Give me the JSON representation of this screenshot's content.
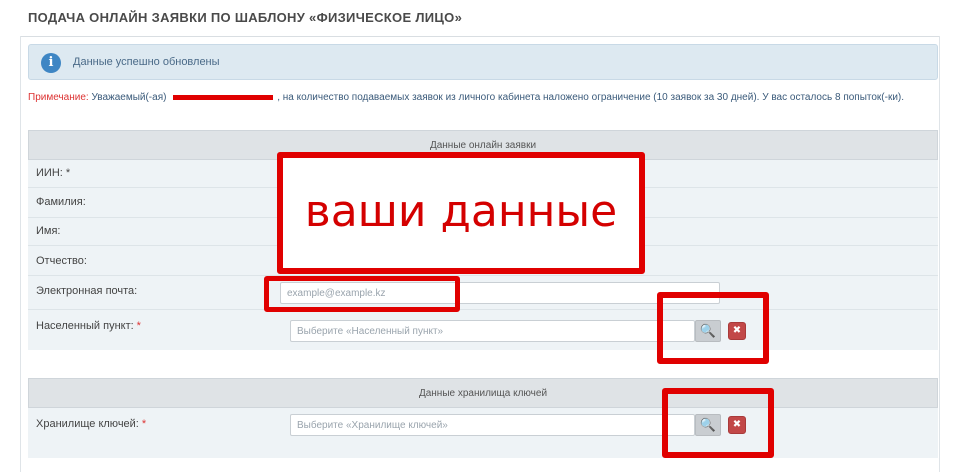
{
  "page": {
    "title": "ПОДАЧА ОНЛАЙН ЗАЯВКИ ПО ШАБЛОНУ «ФИЗИЧЕСКОЕ ЛИЦО»"
  },
  "info": {
    "icon": "info-icon",
    "text": "Данные успешно обновлены"
  },
  "warning": {
    "label": "Примечание:",
    "before": "Уважаемый(-ая)",
    "after": ", на количество подаваемых заявок из личного кабинета наложено ограничение (10 заявок за 30 дней). У вас осталось 8 попыток(-ки)."
  },
  "section1": {
    "title": "Данные онлайн заявки",
    "fields": {
      "iin": "ИИН: *",
      "lastname": "Фамилия:",
      "firstname": "Имя:",
      "patronymic": "Отчество:",
      "email": "Электронная почта:",
      "email_placeholder": "example@example.kz",
      "locality": "Населенный пункт:",
      "locality_placeholder": "Выберите «Населенный пункт»"
    }
  },
  "section2": {
    "title": "Данные хранилища ключей",
    "keystore": "Хранилище ключей:",
    "keystore_placeholder": "Выберите «Хранилище ключей»"
  },
  "required_mark": "*",
  "overlay": {
    "text": "ваши данные"
  },
  "colors": {
    "highlight": "#e00000",
    "info_bg": "#dde9f1",
    "header_bg": "#dfe3e6"
  },
  "icons": {
    "search": "search-icon",
    "clear": "clear-icon"
  }
}
